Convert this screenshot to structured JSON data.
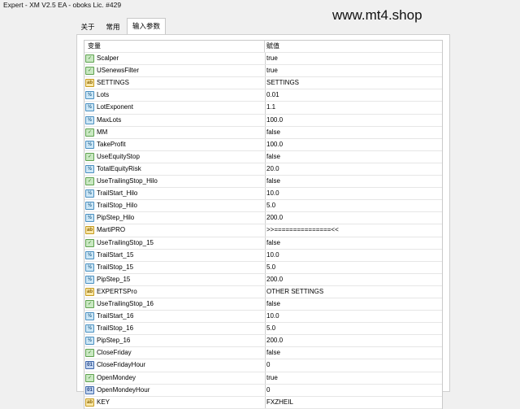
{
  "window": {
    "title": "Expert - XM V2.5 EA - oboks Lic. #429"
  },
  "watermark": "www.mt4.shop",
  "tabs": [
    {
      "label": "关于"
    },
    {
      "label": "常用"
    },
    {
      "label": "输入参数"
    }
  ],
  "table": {
    "headers": {
      "variable": "变量",
      "value": "赋值"
    },
    "rows": [
      {
        "name": "Scalper",
        "value": "true",
        "icon": "bool-type-icon"
      },
      {
        "name": "USenewsFilter",
        "value": "true",
        "icon": "bool-type-icon"
      },
      {
        "name": "SETTINGS",
        "value": "SETTINGS",
        "icon": "string-type-icon"
      },
      {
        "name": "Lots",
        "value": "0.01",
        "icon": "double-type-icon"
      },
      {
        "name": "LotExponent",
        "value": "1.1",
        "icon": "double-type-icon"
      },
      {
        "name": "MaxLots",
        "value": "100.0",
        "icon": "double-type-icon"
      },
      {
        "name": "MM",
        "value": "false",
        "icon": "bool-type-icon"
      },
      {
        "name": "TakeProfit",
        "value": "100.0",
        "icon": "double-type-icon"
      },
      {
        "name": "UseEquityStop",
        "value": "false",
        "icon": "bool-type-icon"
      },
      {
        "name": "TotalEquityRisk",
        "value": "20.0",
        "icon": "double-type-icon"
      },
      {
        "name": "UseTrailingStop_Hilo",
        "value": "false",
        "icon": "bool-type-icon"
      },
      {
        "name": "TrailStart_Hilo",
        "value": "10.0",
        "icon": "double-type-icon"
      },
      {
        "name": "TrailStop_Hilo",
        "value": "5.0",
        "icon": "double-type-icon"
      },
      {
        "name": "PipStep_Hilo",
        "value": "200.0",
        "icon": "double-type-icon"
      },
      {
        "name": "MartiPRO",
        "value": ">>===============<<",
        "icon": "string-type-icon"
      },
      {
        "name": "UseTrailingStop_15",
        "value": "false",
        "icon": "bool-type-icon"
      },
      {
        "name": "TrailStart_15",
        "value": "10.0",
        "icon": "double-type-icon"
      },
      {
        "name": "TrailStop_15",
        "value": "5.0",
        "icon": "double-type-icon"
      },
      {
        "name": "PipStep_15",
        "value": "200.0",
        "icon": "double-type-icon"
      },
      {
        "name": "EXPERTSPro",
        "value": "OTHER SETTINGS",
        "icon": "string-type-icon"
      },
      {
        "name": "UseTrailingStop_16",
        "value": "false",
        "icon": "bool-type-icon"
      },
      {
        "name": "TrailStart_16",
        "value": "10.0",
        "icon": "double-type-icon"
      },
      {
        "name": "TrailStop_16",
        "value": "5.0",
        "icon": "double-type-icon"
      },
      {
        "name": "PipStep_16",
        "value": "200.0",
        "icon": "double-type-icon"
      },
      {
        "name": "CloseFriday",
        "value": "false",
        "icon": "bool-type-icon"
      },
      {
        "name": "CloseFridayHour",
        "value": "0",
        "icon": "int-type-icon"
      },
      {
        "name": "OpenMondey",
        "value": "true",
        "icon": "bool-type-icon"
      },
      {
        "name": "OpenMondeyHour",
        "value": "0",
        "icon": "int-type-icon"
      },
      {
        "name": "KEY",
        "value": "FXZHEIL",
        "icon": "string-type-icon"
      }
    ]
  }
}
